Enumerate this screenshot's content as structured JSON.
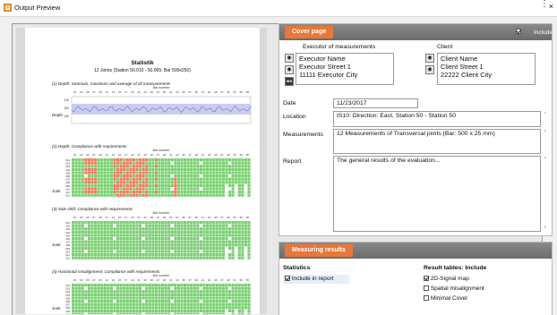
{
  "window": {
    "title": "Output Preview",
    "close": "×",
    "overflow": "⋮"
  },
  "report": {
    "title": "Statistik",
    "subtitle": "12 Joints (Station 50.010 - 50.065; Bar 500x250)",
    "sections": [
      {
        "label": "(1) Depth: minimum, maximum and average of all measurements",
        "axis_title": "Bar number",
        "row_label": "Depth",
        "y_ticks": [
          "110",
          "120",
          "130"
        ]
      },
      {
        "label": "(2) Depth: Compliance with requirements",
        "axis_title": "Bar number",
        "row_label": "Joint"
      },
      {
        "label": "(3) Side shift: Compliance with requirements",
        "axis_title": "Bar number",
        "row_label": "Joint"
      },
      {
        "label": "(4) Horizontal misalignment: Compliance with requirements",
        "axis_title": "Bar number",
        "row_label": "Joint"
      }
    ],
    "bar_numbers": [
      "01",
      "03",
      "05",
      "07",
      "09",
      "11",
      "13",
      "15",
      "17",
      "19",
      "21",
      "23",
      "25",
      "27",
      "29",
      "31",
      "33",
      "35",
      "37",
      "39",
      "41",
      "43",
      "45",
      "47",
      "49",
      "51",
      "53",
      "55"
    ],
    "joint_labels": [
      "001",
      "002",
      "003",
      "004",
      "005",
      "006",
      "007",
      "008",
      "009",
      "010",
      "011",
      "012"
    ],
    "colors": {
      "ok": "#7bcf73",
      "fail": "#ef7b5e",
      "range": "#c9cdf0",
      "avg": "#6f76c6"
    }
  },
  "cover": {
    "tab": "Cover page",
    "include_label": "Include",
    "include_checked": true,
    "executor": {
      "label": "Executor of measurements",
      "lines": [
        "Executor Name",
        "Executor Street 1",
        "11111 Executor City"
      ],
      "logo_text": "IBS"
    },
    "client": {
      "label": "Client",
      "lines": [
        "Client Name",
        "Client Street 1",
        "22222 Client City"
      ]
    },
    "date": {
      "label": "Date",
      "value": "11/23/2017"
    },
    "location": {
      "label": "Location",
      "value": "IS10: Direction: East, Station 50 - Station 50"
    },
    "measurements": {
      "label": "Measurements",
      "value": "12 Measurements of Transversal joints (Bar: 500 x 25 mm)"
    },
    "report": {
      "label": "Report",
      "value": "The general results of the evaluation..."
    }
  },
  "results": {
    "tab": "Measuring results",
    "statistics": {
      "heading": "Statistics",
      "include_label": "Include in report",
      "checked": true
    },
    "tables": {
      "heading": "Result tables: Include",
      "options": [
        {
          "label": "2D-Signal map",
          "checked": true
        },
        {
          "label": "Spatial misalignment",
          "checked": false
        },
        {
          "label": "Minimal Cover",
          "checked": false
        }
      ]
    }
  }
}
